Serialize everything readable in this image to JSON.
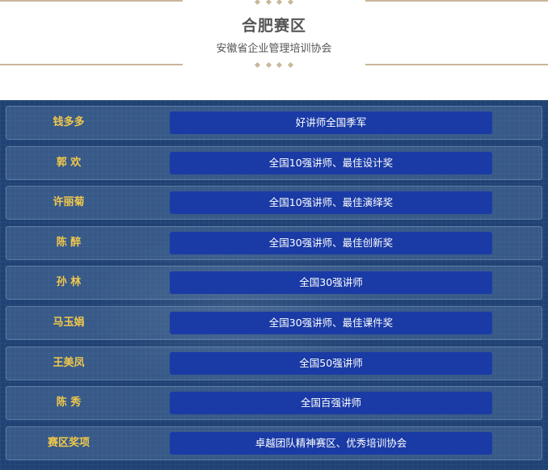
{
  "header": {
    "title": "合肥赛区",
    "subtitle": "安徽省企业管理培训协会"
  },
  "rows": [
    {
      "name": "钱多多",
      "award": "好讲师全国季军"
    },
    {
      "name": "郭  欢",
      "award": "全国10强讲师、最佳设计奖"
    },
    {
      "name": "许丽菊",
      "award": "全国10强讲师、最佳演绎奖"
    },
    {
      "name": "陈  醉",
      "award": "全国30强讲师、最佳创新奖"
    },
    {
      "name": "孙  林",
      "award": "全国30强讲师"
    },
    {
      "name": "马玉娟",
      "award": "全国30强讲师、最佳课件奖"
    },
    {
      "name": "王美凤",
      "award": "全国50强讲师"
    },
    {
      "name": "陈  秀",
      "award": "全国百强讲师"
    },
    {
      "name": "赛区奖项",
      "award": "卓越团队精神赛区、优秀培训协会"
    }
  ],
  "colors": {
    "name_text": "#f1c84b",
    "award_bg": "#1a3ba6",
    "board_bg": "#1f4274",
    "ornament": "#c9b79a"
  }
}
